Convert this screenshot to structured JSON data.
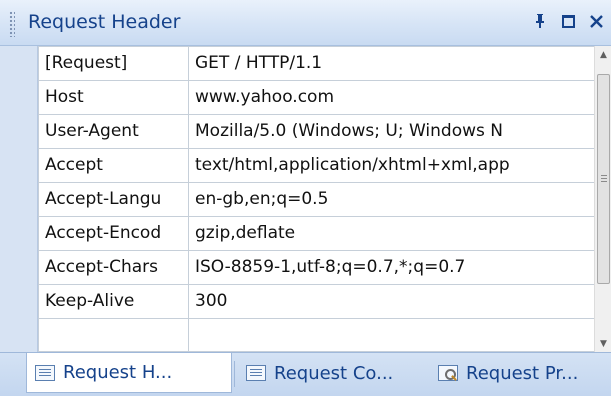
{
  "panel": {
    "title": "Request Header"
  },
  "title_buttons": {
    "pin": "ᵖ",
    "maximize": "",
    "close": "✕"
  },
  "grid": {
    "rows": [
      {
        "key": "[Request]",
        "value": "GET / HTTP/1.1"
      },
      {
        "key": "Host",
        "value": "www.yahoo.com"
      },
      {
        "key": "User-Agent",
        "value": "Mozilla/5.0 (Windows; U; Windows N"
      },
      {
        "key": "Accept",
        "value": "text/html,application/xhtml+xml,app"
      },
      {
        "key": "Accept-Langu",
        "value": "en-gb,en;q=0.5"
      },
      {
        "key": "Accept-Encod",
        "value": "gzip,deflate"
      },
      {
        "key": "Accept-Chars",
        "value": "ISO-8859-1,utf-8;q=0.7,*;q=0.7"
      },
      {
        "key": "Keep-Alive",
        "value": "300"
      },
      {
        "key": "",
        "value": ""
      }
    ]
  },
  "tabs": [
    {
      "label": "Request H...",
      "icon": "sheet-icon",
      "active": true
    },
    {
      "label": "Request Co...",
      "icon": "sheet-icon",
      "active": false
    },
    {
      "label": "Request Pr...",
      "icon": "magnifier-icon",
      "active": false
    }
  ],
  "colors": {
    "title_text": "#15428b",
    "title_bg": "#d6e4f6",
    "tab_strip_bg": "#c3d6ef"
  }
}
